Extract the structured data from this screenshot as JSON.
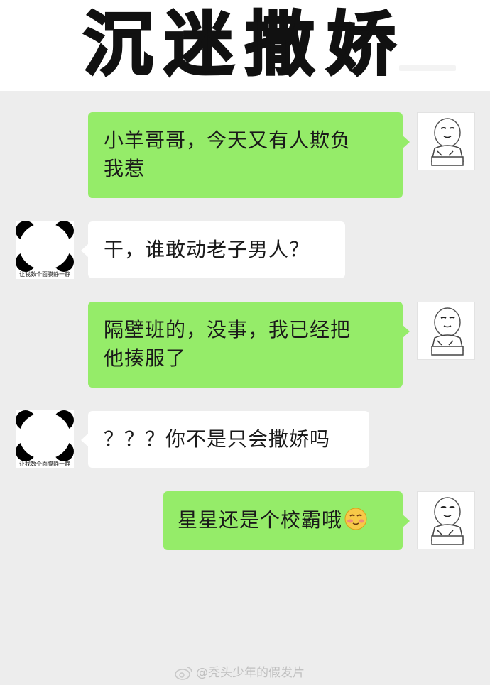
{
  "header": {
    "title": "沉迷撒娇"
  },
  "messages": [
    {
      "side": "right",
      "text_line1": "小羊哥哥，今天又有人欺负",
      "text_line2": "我惹",
      "avatar": "meme-cat-face"
    },
    {
      "side": "left",
      "text": "干，谁敢动老子男人？",
      "avatar": "panda-avatar",
      "avatar_caption": "让我数个面膜静一静"
    },
    {
      "side": "right",
      "text_line1": "隔壁班的，没事，我已经把",
      "text_line2": "他揍服了",
      "avatar": "meme-cat-face"
    },
    {
      "side": "left",
      "text": "？？？你不是只会撒娇吗",
      "avatar": "panda-avatar",
      "avatar_caption": "让我数个面膜静一静"
    },
    {
      "side": "right",
      "text": "星星还是个校霸哦",
      "emoji": "shy-face-emoji",
      "avatar": "meme-cat-face"
    }
  ],
  "watermark": {
    "text": "@秃头少年的假发片",
    "icon": "weibo-icon"
  },
  "colors": {
    "green_bubble": "#95ec69",
    "white_bubble": "#ffffff",
    "background": "#ededed"
  }
}
